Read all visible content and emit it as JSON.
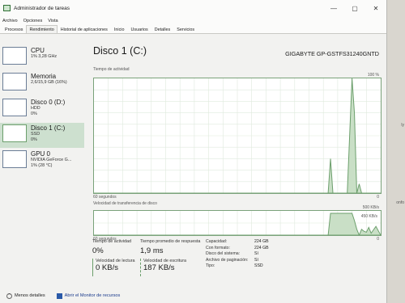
{
  "window": {
    "title": "Administrador de tareas",
    "controls": [
      "—",
      "▢",
      "✕"
    ]
  },
  "menu": [
    "Archivo",
    "Opciones",
    "Vista"
  ],
  "tabs": [
    "Procesos",
    "Rendimiento",
    "Historial de aplicaciones",
    "Inicio",
    "Usuarios",
    "Detalles",
    "Servicios"
  ],
  "sidebar": [
    {
      "title": "CPU",
      "sub1": "1% 3,28 GHz",
      "sub2": ""
    },
    {
      "title": "Memoria",
      "sub1": "2,6/15,9 GB (16%)",
      "sub2": ""
    },
    {
      "title": "Disco 0 (D:)",
      "sub1": "HDD",
      "sub2": "0%"
    },
    {
      "title": "Disco 1 (C:)",
      "sub1": "SSD",
      "sub2": "0%"
    },
    {
      "title": "GPU 0",
      "sub1": "NVIDIA GeForce G...",
      "sub2": "1% (28 °C)"
    }
  ],
  "main": {
    "title": "Disco 1 (C:)",
    "model": "GIGABYTE GP-GSTFS31240GNTD",
    "activity_label": "Tiempo de actividad",
    "activity_max": "100 %",
    "activity_time_left": "60 segundos",
    "activity_time_right": "0",
    "transfer_label": "Velocidad de transferencia de disco",
    "transfer_max": "500 KB/s",
    "transfer_mid": "450 KB/s",
    "transfer_time_left": "60 segundos",
    "transfer_time_right": "0"
  },
  "stats": {
    "active_time_label": "Tiempo de actividad",
    "active_time_value": "0%",
    "avg_response_label": "Tiempo promedio de respuesta",
    "avg_response_value": "1,9 ms",
    "read_label": "Velocidad de lectura",
    "read_value": "0 KB/s",
    "write_label": "Velocidad de escritura",
    "write_value": "187 KB/s"
  },
  "properties": [
    {
      "k": "Capacidad:",
      "v": "224 GB"
    },
    {
      "k": "Con formato:",
      "v": "224 GB"
    },
    {
      "k": "Disco del sistema:",
      "v": "Sí"
    },
    {
      "k": "Archivo de paginación:",
      "v": "Sí"
    },
    {
      "k": "Tipo:",
      "v": "SSD"
    }
  ],
  "footer": {
    "less_details": "Menos detalles",
    "resource_monitor": "Abrir el Monitor de recursos"
  },
  "chart_data": [
    {
      "type": "area",
      "title": "Tiempo de actividad",
      "ylim": [
        0,
        100
      ],
      "x": [
        60,
        55,
        50,
        45,
        40,
        35,
        30,
        25,
        20,
        15,
        12,
        11,
        10.5,
        10,
        9.5,
        9,
        8,
        7,
        6.5,
        6,
        5.5,
        5,
        4.5,
        4,
        3,
        2,
        1,
        0
      ],
      "values": [
        0,
        0,
        0,
        0,
        0,
        0,
        0,
        0,
        0,
        0,
        0,
        0,
        30,
        0,
        0,
        0,
        0,
        0,
        50,
        100,
        70,
        0,
        8,
        0,
        0,
        0,
        0,
        0
      ]
    },
    {
      "type": "area",
      "title": "Velocidad de transferencia de disco",
      "ylim": [
        0,
        500
      ],
      "x": [
        60,
        50,
        40,
        30,
        20,
        15,
        12,
        11,
        10.5,
        10,
        9,
        8,
        7,
        6,
        5.5,
        5,
        4.5,
        4,
        3.5,
        3,
        2.5,
        2,
        1,
        0
      ],
      "values": [
        0,
        0,
        0,
        0,
        0,
        0,
        0,
        0,
        450,
        450,
        450,
        450,
        450,
        450,
        300,
        120,
        0,
        120,
        80,
        60,
        160,
        40,
        180,
        0
      ]
    }
  ],
  "background_text": [
    "ly",
    "onfo"
  ]
}
